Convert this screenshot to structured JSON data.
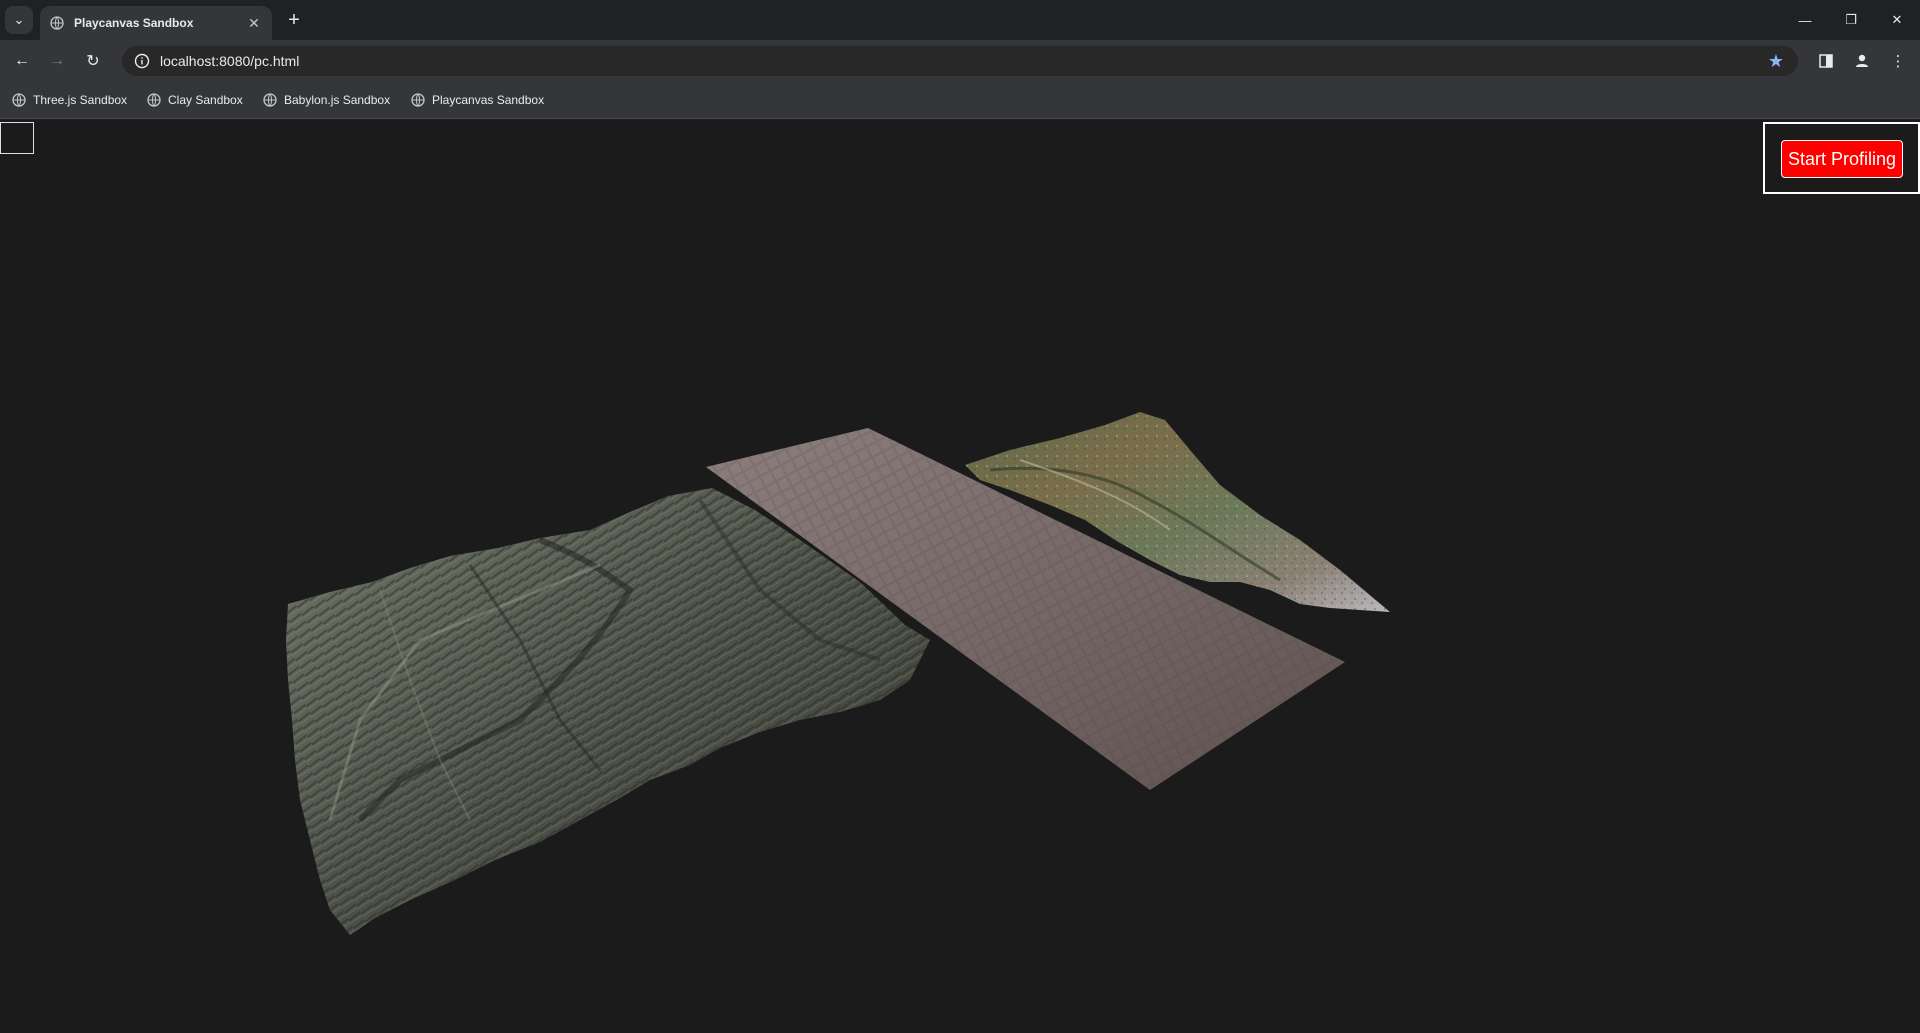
{
  "tab": {
    "title": "Playcanvas Sandbox",
    "close": "✕",
    "new_tab": "+"
  },
  "window": {
    "minimize": "—",
    "restore": "❐",
    "close": "✕"
  },
  "toolbar": {
    "url": "localhost:8080/pc.html"
  },
  "bookmarks": [
    {
      "label": "Three.js Sandbox"
    },
    {
      "label": "Clay Sandbox"
    },
    {
      "label": "Babylon.js Sandbox"
    },
    {
      "label": "Playcanvas Sandbox"
    }
  ],
  "profiler": {
    "button_label": "Start Profiling",
    "button_color": "#ff0000"
  },
  "colors": {
    "accent": "#8ab4f8",
    "background": "#1b1b1b"
  }
}
